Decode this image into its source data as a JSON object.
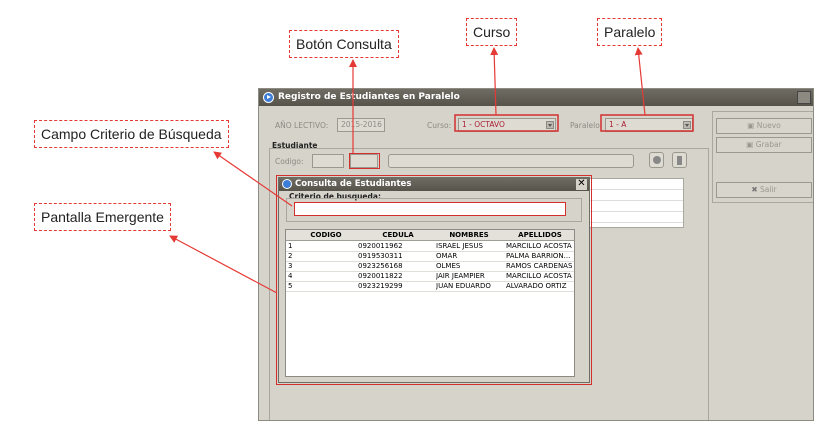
{
  "callouts": {
    "boton_consulta": "Botón Consulta",
    "curso": "Curso",
    "paralelo": "Paralelo",
    "campo_criterio": "Campo Criterio de Búsqueda",
    "pantalla_emergente": "Pantalla Emergente"
  },
  "window": {
    "title": "Registro de Estudiantes en Paralelo",
    "year_label": "AÑO LECTIVO:",
    "year_value": "2015-2016",
    "curso_label": "Curso:",
    "curso_value": "1 - OCTAVO",
    "paralelo_label": "Paralelo:",
    "paralelo_value": "1 - A",
    "estudiante_group": "Estudiante",
    "codigo_label": "Codigo:",
    "buttons": {
      "nuevo": "Nuevo",
      "grabar": "Grabar",
      "salir": "Salir"
    }
  },
  "dialog": {
    "title": "Consulta de Estudiantes",
    "close": "✕",
    "criterio_label": "Criterio de busqueda:",
    "criterio_value": "",
    "columns": [
      "CODIGO",
      "CEDULA",
      "NOMBRES",
      "APELLIDOS"
    ],
    "rows": [
      [
        "1",
        "0920011962",
        "ISRAEL JESUS",
        "MARCILLO ACOSTA"
      ],
      [
        "2",
        "0919530311",
        "OMAR",
        "PALMA BARRION..."
      ],
      [
        "3",
        "0923256168",
        "OLMES",
        "RAMOS CARDENAS"
      ],
      [
        "4",
        "0920011822",
        "JAIR JEAMPIER",
        "MARCILLO ACOSTA"
      ],
      [
        "5",
        "0923219299",
        "JUAN EDUARDO",
        "ALVARADO ORTIZ"
      ]
    ]
  },
  "colors": {
    "annotation": "#e53935",
    "titlebar": "#5f5c54",
    "window_bg": "#d6d3ca"
  }
}
